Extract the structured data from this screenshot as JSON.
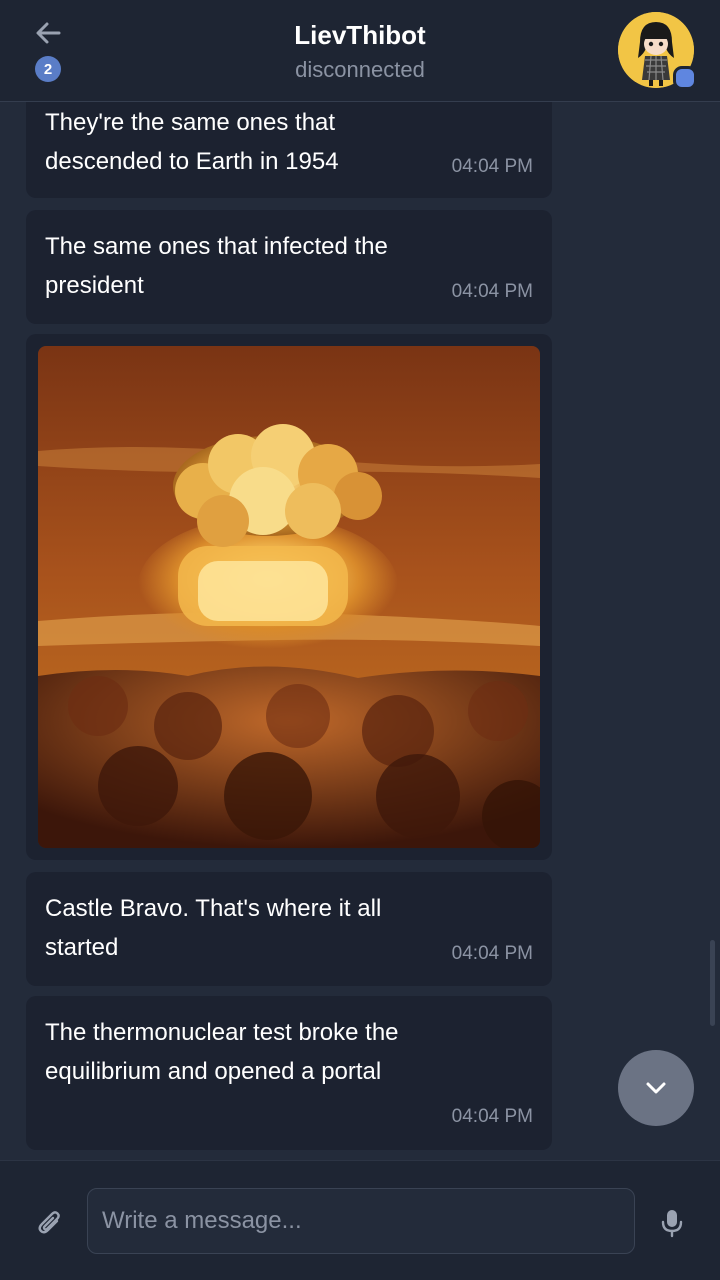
{
  "header": {
    "back_icon": "arrow-left-icon",
    "unread_count": "2",
    "title": "LievThibot",
    "status": "disconnected",
    "avatar_icon": "bot-avatar",
    "online_indicator_color": "#5f86e0"
  },
  "messages": [
    {
      "type": "text",
      "text": "They're the same ones that descended to Earth in 1954",
      "time": "04:04 PM"
    },
    {
      "type": "text",
      "text": "The same ones that infected the president",
      "time": "04:04 PM"
    },
    {
      "type": "image",
      "image": "mushroom-cloud-photo"
    },
    {
      "type": "text",
      "text": "Castle Bravo. That's where it all started",
      "time": "04:04 PM"
    },
    {
      "type": "text",
      "text": "The thermonuclear test broke the equilibrium and opened a portal",
      "time": "04:04 PM"
    }
  ],
  "scroll_down_icon": "chevron-down-icon",
  "composer": {
    "attach_icon": "paperclip-icon",
    "input_value": "",
    "input_placeholder": "Write a message...",
    "mic_icon": "microphone-icon"
  },
  "colors": {
    "background": "#232b3a",
    "header": "#1e2533",
    "bubble": "#1c2230",
    "accent": "#5a7dc7",
    "muted_text": "#8b93a3",
    "fab": "#6b7384"
  }
}
